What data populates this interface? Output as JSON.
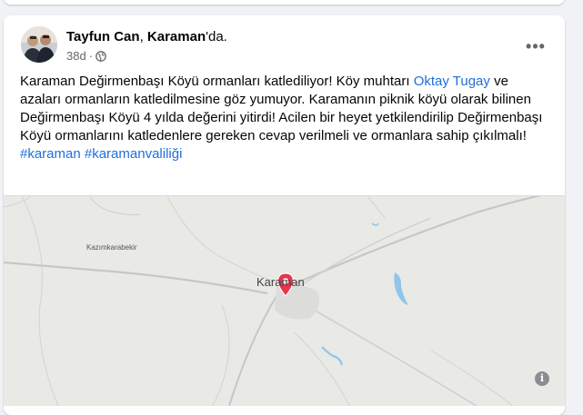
{
  "post": {
    "author": "Tayfun Can",
    "separator": ", ",
    "place": "Karaman",
    "place_suffix": "'da.",
    "time": "38d",
    "dot": "·",
    "more_label": "•••",
    "text_part1": "Karaman Değirmenbaşı Köyü ormanları katlediliyor! Köy muhtarı ",
    "mention": "Oktay Tugay",
    "text_part2": " ve azaları ormanların katledilmesine göz yumuyor. Karamanın piknik köyü olarak bilinen Değirmenbaşı Köyü 4 yılda değerini yitirdi! Acilen bir heyet yetkilendirilip Değirmenbaşı Köyü ormanlarını katledenlere gereken cevap verilmeli ve ormanlara sahip çıkılmalı!",
    "hashtag1": "#karaman",
    "hashtag_sep": " ",
    "hashtag2": "#karamanvaliliği"
  },
  "map": {
    "village_label": "Kazımkarabekir",
    "city_label": "Karaman",
    "info_label": "i",
    "pin_color": "#e8344d",
    "water_color": "#8fc6ea",
    "land_color": "#e9e9e6"
  },
  "icons": {
    "privacy": "globe-icon",
    "menu": "more-icon",
    "location": "map-pin-icon"
  }
}
